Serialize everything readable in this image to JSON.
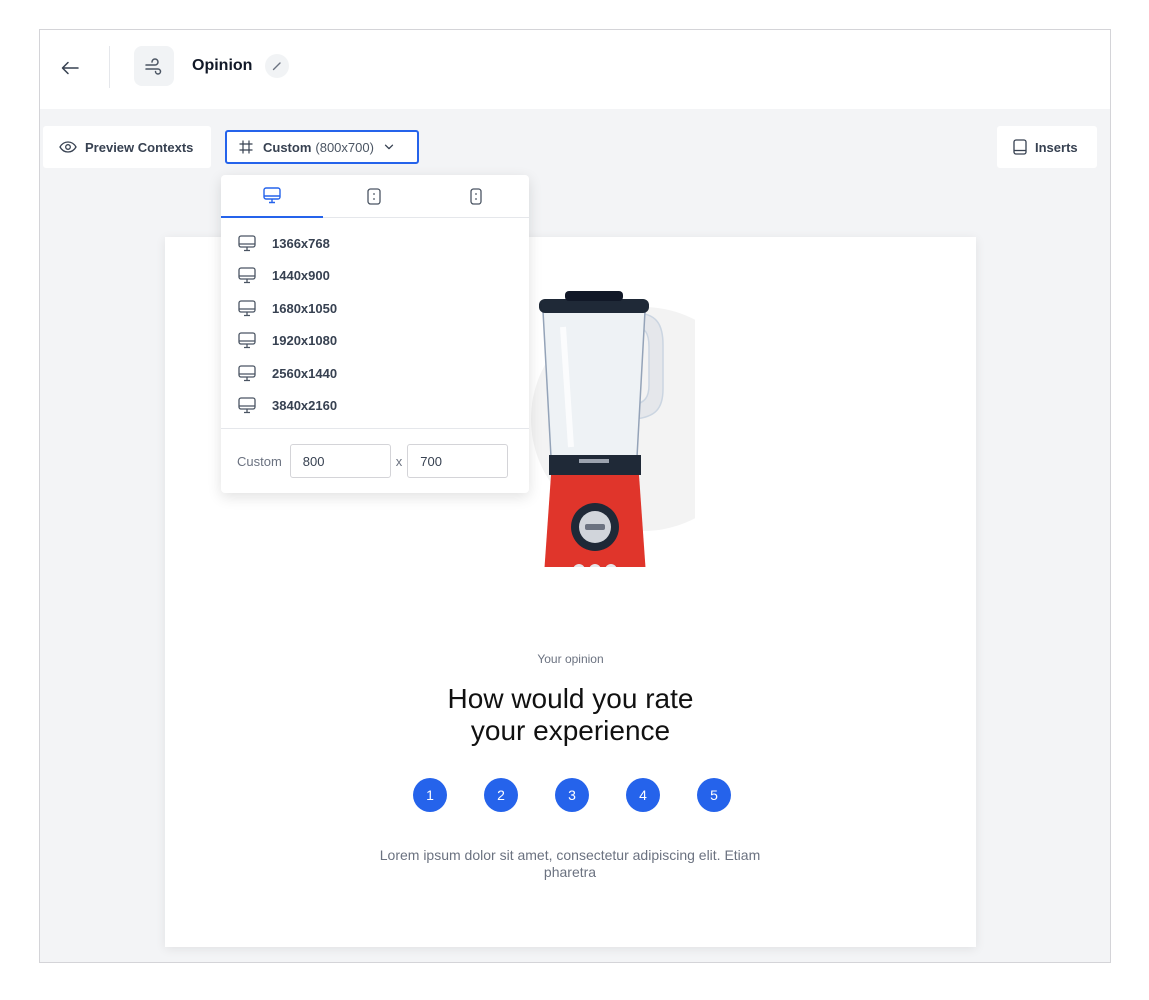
{
  "header": {
    "title": "Opinion",
    "back_icon": "arrow-left-icon",
    "app_icon": "wind-icon",
    "edit_icon": "pencil-icon"
  },
  "toolbar": {
    "preview_contexts_label": "Preview Contexts",
    "viewport_label": "Custom",
    "viewport_dimensions": "(800x700)",
    "inserts_label": "Inserts"
  },
  "viewport_dropdown": {
    "tabs": [
      "desktop",
      "tablet",
      "mobile"
    ],
    "active_tab": "desktop",
    "resolutions": [
      "1366x768",
      "1440x900",
      "1680x1050",
      "1920x1080",
      "2560x1440",
      "3840x2160"
    ],
    "custom_label": "Custom",
    "custom_width": "800",
    "separator": "x",
    "custom_height": "700"
  },
  "preview": {
    "eyebrow": "Your opinion",
    "headline_line1": "How would you rate",
    "headline_line2": "your experience",
    "ratings": [
      "1",
      "2",
      "3",
      "4",
      "5"
    ],
    "body": "Lorem ipsum dolor sit amet, consectetur adipiscing elit. Etiam pharetra"
  },
  "colors": {
    "accent": "#2563eb",
    "blender_red": "#e0352b",
    "background": "#f3f4f6"
  }
}
